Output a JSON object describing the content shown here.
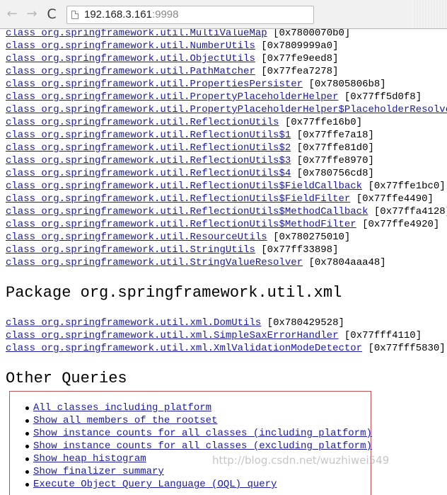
{
  "browser": {
    "back_icon": "←",
    "forward_icon": "→",
    "reload_icon": "C",
    "url_host": "192.168.3.161",
    "url_port": ":9998"
  },
  "classes_top": [
    {
      "name": "class org.springframework.util.MultiValueMap",
      "addr": "[0x7800070b0]"
    },
    {
      "name": "class org.springframework.util.NumberUtils",
      "addr": "[0x7809999a0]"
    },
    {
      "name": "class org.springframework.util.ObjectUtils",
      "addr": "[0x77fe9eed8]"
    },
    {
      "name": "class org.springframework.util.PathMatcher",
      "addr": "[0x77fea7278]"
    },
    {
      "name": "class org.springframework.util.PropertiesPersister",
      "addr": "[0x7805806b8]"
    },
    {
      "name": "class org.springframework.util.PropertyPlaceholderHelper",
      "addr": "[0x77ff5d0f8]"
    },
    {
      "name": "class org.springframework.util.PropertyPlaceholderHelper$PlaceholderResolver",
      "addr": "["
    },
    {
      "name": "class org.springframework.util.ReflectionUtils",
      "addr": "[0x77ffe16b0]"
    },
    {
      "name": "class org.springframework.util.ReflectionUtils$1",
      "addr": "[0x77ffe7a18]"
    },
    {
      "name": "class org.springframework.util.ReflectionUtils$2",
      "addr": "[0x77ffe81d0]"
    },
    {
      "name": "class org.springframework.util.ReflectionUtils$3",
      "addr": "[0x77ffe8970]"
    },
    {
      "name": "class org.springframework.util.ReflectionUtils$4",
      "addr": "[0x780756cd8]"
    },
    {
      "name": "class org.springframework.util.ReflectionUtils$FieldCallback",
      "addr": "[0x77ffe1bc0]"
    },
    {
      "name": "class org.springframework.util.ReflectionUtils$FieldFilter",
      "addr": "[0x77ffe4490]"
    },
    {
      "name": "class org.springframework.util.ReflectionUtils$MethodCallback",
      "addr": "[0x77ffa4128]"
    },
    {
      "name": "class org.springframework.util.ReflectionUtils$MethodFilter",
      "addr": "[0x77ffe4920]"
    },
    {
      "name": "class org.springframework.util.ResourceUtils",
      "addr": "[0x780275010]"
    },
    {
      "name": "class org.springframework.util.StringUtils",
      "addr": "[0x77ff33898]"
    },
    {
      "name": "class org.springframework.util.StringValueResolver",
      "addr": "[0x7804aaa48]"
    }
  ],
  "package_heading": "Package org.springframework.util.xml",
  "classes_xml": [
    {
      "name": "class org.springframework.util.xml.DomUtils",
      "addr": "[0x780429528]"
    },
    {
      "name": "class org.springframework.util.xml.SimpleSaxErrorHandler",
      "addr": "[0x77fff4110]"
    },
    {
      "name": "class org.springframework.util.xml.XmlValidationModeDetector",
      "addr": "[0x77fff5830]"
    }
  ],
  "other_queries_heading": "Other Queries",
  "queries": [
    "All classes including platform",
    "Show all members of the rootset",
    "Show instance counts for all classes (including platform)",
    "Show instance counts for all classes (excluding platform)",
    "Show heap histogram",
    "Show finalizer summary",
    "Execute Object Query Language (OQL) query"
  ],
  "watermark": "http://blog.csdn.net/wuzhiwei549"
}
